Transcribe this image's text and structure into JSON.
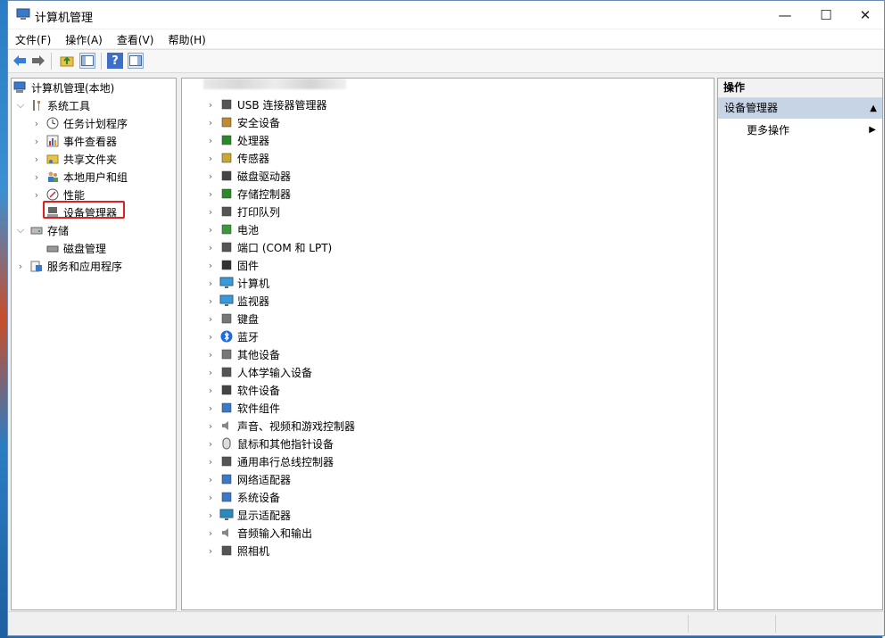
{
  "window": {
    "title": "计算机管理"
  },
  "controls": {
    "minimize": "—",
    "maximize": "☐",
    "close": "✕"
  },
  "menu": [
    "文件(F)",
    "操作(A)",
    "查看(V)",
    "帮助(H)"
  ],
  "tree": {
    "root": "计算机管理(本地)",
    "system_tools": "系统工具",
    "task_scheduler": "任务计划程序",
    "event_viewer": "事件查看器",
    "shared_folders": "共享文件夹",
    "local_users": "本地用户和组",
    "performance": "性能",
    "device_manager": "设备管理器",
    "storage": "存储",
    "disk_management": "磁盘管理",
    "services_apps": "服务和应用程序"
  },
  "devices": [
    "USB 连接器管理器",
    "安全设备",
    "处理器",
    "传感器",
    "磁盘驱动器",
    "存储控制器",
    "打印队列",
    "电池",
    "端口 (COM 和 LPT)",
    "固件",
    "计算机",
    "监视器",
    "键盘",
    "蓝牙",
    "其他设备",
    "人体学输入设备",
    "软件设备",
    "软件组件",
    "声音、视频和游戏控制器",
    "鼠标和其他指针设备",
    "通用串行总线控制器",
    "网络适配器",
    "系统设备",
    "显示适配器",
    "音频输入和输出",
    "照相机"
  ],
  "actions": {
    "header": "操作",
    "group": "设备管理器",
    "more": "更多操作"
  },
  "colors": {
    "selection_outline": "#e02020",
    "action_group_bg": "#c6d4e6"
  }
}
